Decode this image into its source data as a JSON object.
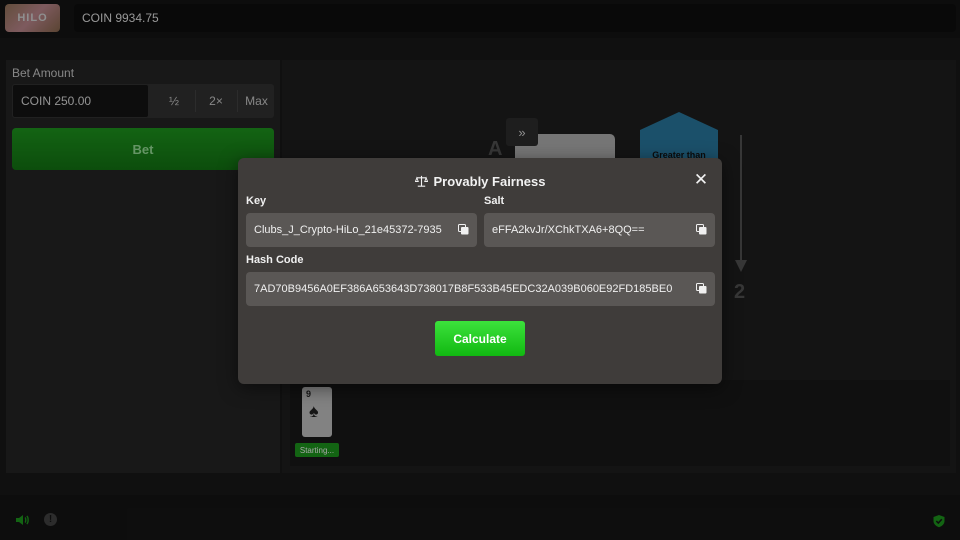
{
  "topbar": {
    "logo_text": "HILO",
    "balance": "COIN 9934.75"
  },
  "bet_panel": {
    "label": "Bet Amount",
    "amount": "COIN 250.00",
    "half_label": "½",
    "double_label": "2×",
    "max_label": "Max",
    "bet_label": "Bet"
  },
  "game": {
    "skip_label": "»",
    "bg_letter": "A",
    "hex_label": "Greater than",
    "arrow_number": "2",
    "history": {
      "card_rank": "9",
      "card_suit": "♠",
      "badge": "Starting..."
    }
  },
  "modal": {
    "title": "Provably Fairness",
    "close_label": "✕",
    "key_label": "Key",
    "key_value": "Clubs_J_Crypto-HiLo_21e45372-7935",
    "salt_label": "Salt",
    "salt_value": "eFFA2kvJr/XChkTXA6+8QQ==",
    "hash_label": "Hash Code",
    "hash_value": "7AD70B9456A0EF386A653643D738017B8F533B45EDC32A039B060E92FD185BE0",
    "calculate_label": "Calculate"
  },
  "colors": {
    "accent_green": "#1e9a1e",
    "calculate_green": "#22cc22",
    "hex_blue": "#2a7ca3"
  },
  "icons": {
    "sound": "speaker-icon",
    "info": "info-icon",
    "shield": "shield-check-icon",
    "scale": "scale-icon",
    "copy": "copy-icon"
  }
}
